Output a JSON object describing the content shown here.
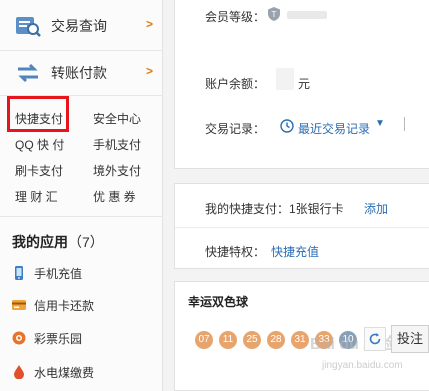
{
  "sidebar": {
    "big_items": [
      {
        "label": "交易查询",
        "arrow": ">"
      },
      {
        "label": "转账付款",
        "arrow": ">"
      }
    ],
    "quick_links": [
      {
        "label": "快捷支付"
      },
      {
        "label": "安全中心"
      },
      {
        "label": "QQ 快 付"
      },
      {
        "label": "手机支付"
      },
      {
        "label": "刷卡支付"
      },
      {
        "label": "境外支付"
      },
      {
        "label": "理 财 汇"
      },
      {
        "label": "优 惠 券"
      }
    ],
    "apps_title": "我的应用",
    "apps_count": "（7）",
    "apps": [
      {
        "label": "手机充值"
      },
      {
        "label": "信用卡还款"
      },
      {
        "label": "彩票乐园"
      },
      {
        "label": "水电煤缴费"
      }
    ]
  },
  "account": {
    "member_level_label": "会员等级：",
    "balance_label": "账户余额：",
    "balance_unit": "元",
    "records_label": "交易记录：",
    "records_link": "最近交易记录"
  },
  "quickpay": {
    "my_quickpay_label": "我的快捷支付：",
    "card_count": "1张银行卡",
    "add_link": "添加",
    "privilege_label": "快捷特权：",
    "privilege_link": "快捷充值"
  },
  "lottery": {
    "title": "幸运双色球",
    "red_balls": [
      "07",
      "11",
      "25",
      "28",
      "31",
      "33"
    ],
    "blue_ball": "10",
    "bet_label": "投注",
    "watermark": "Bai du 经验",
    "watermark_sub": "jingyan.baidu.com"
  },
  "colors": {
    "highlight": "#e8141b",
    "link": "#2a6db3",
    "arrow": "#e07a10",
    "red_ball": "#e8a46d",
    "blue_ball": "#8aa0b8"
  }
}
